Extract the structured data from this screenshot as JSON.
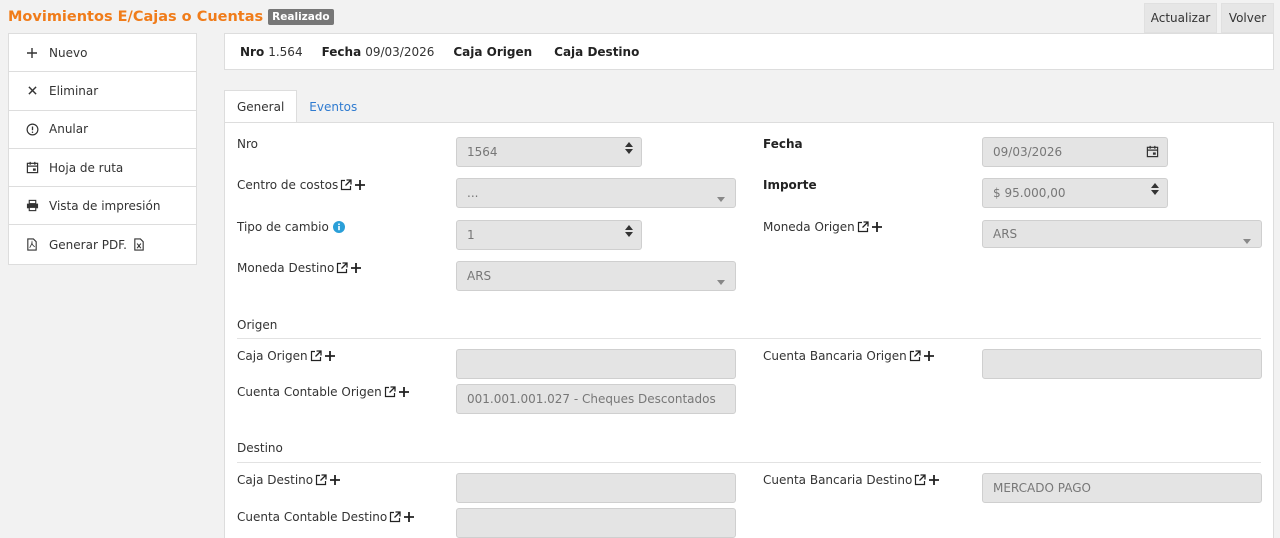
{
  "page": {
    "title": "Movimientos E/Cajas o Cuentas",
    "status_badge": "Realizado"
  },
  "toolbar": {
    "refresh_label": "Actualizar",
    "back_label": "Volver"
  },
  "sidebar": {
    "items": [
      {
        "label": "Nuevo",
        "icon": "plus-icon"
      },
      {
        "label": "Eliminar",
        "icon": "close-icon"
      },
      {
        "label": "Anular",
        "icon": "exclamation-circle-icon"
      },
      {
        "label": "Hoja de ruta",
        "icon": "calendar-icon"
      },
      {
        "label": "Vista de impresión",
        "icon": "print-icon"
      },
      {
        "label": "Generar PDF.",
        "icon": "pdf-icon",
        "extra_icon": "excel-icon"
      }
    ]
  },
  "header": {
    "nro_label": "Nro",
    "nro_value": "1.564",
    "fecha_label": "Fecha",
    "fecha_value": "09/03/2026",
    "caja_origen_label": "Caja Origen",
    "caja_destino_label": "Caja Destino"
  },
  "tabs": [
    {
      "label": "General",
      "active": true
    },
    {
      "label": "Eventos",
      "active": false
    }
  ],
  "form": {
    "nro": {
      "label": "Nro",
      "value": "1564"
    },
    "fecha": {
      "label": "Fecha",
      "value": "09/03/2026"
    },
    "centro_costos": {
      "label": "Centro de costos",
      "value": "..."
    },
    "importe": {
      "label": "Importe",
      "value": "$ 95.000,00"
    },
    "tipo_cambio": {
      "label": "Tipo de cambio",
      "value": "1"
    },
    "moneda_origen": {
      "label": "Moneda Origen",
      "value": "ARS"
    },
    "moneda_destino": {
      "label": "Moneda Destino",
      "value": "ARS"
    },
    "origen_section": "Origen",
    "caja_origen": {
      "label": "Caja Origen",
      "value": ""
    },
    "cuenta_bancaria_origen": {
      "label": "Cuenta Bancaria Origen",
      "value": ""
    },
    "cuenta_contable_origen": {
      "label": "Cuenta Contable Origen",
      "value": "001.001.001.027 - Cheques Descontados"
    },
    "destino_section": "Destino",
    "caja_destino": {
      "label": "Caja Destino",
      "value": ""
    },
    "cuenta_bancaria_destino": {
      "label": "Cuenta Bancaria Destino",
      "value": "MERCADO PAGO"
    },
    "cuenta_contable_destino": {
      "label": "Cuenta Contable Destino",
      "value": ""
    }
  },
  "colors": {
    "title": "#f07c1a",
    "link": "#2f7bd0",
    "info": "#2a9fd8",
    "field_bg": "#e4e4e4"
  }
}
